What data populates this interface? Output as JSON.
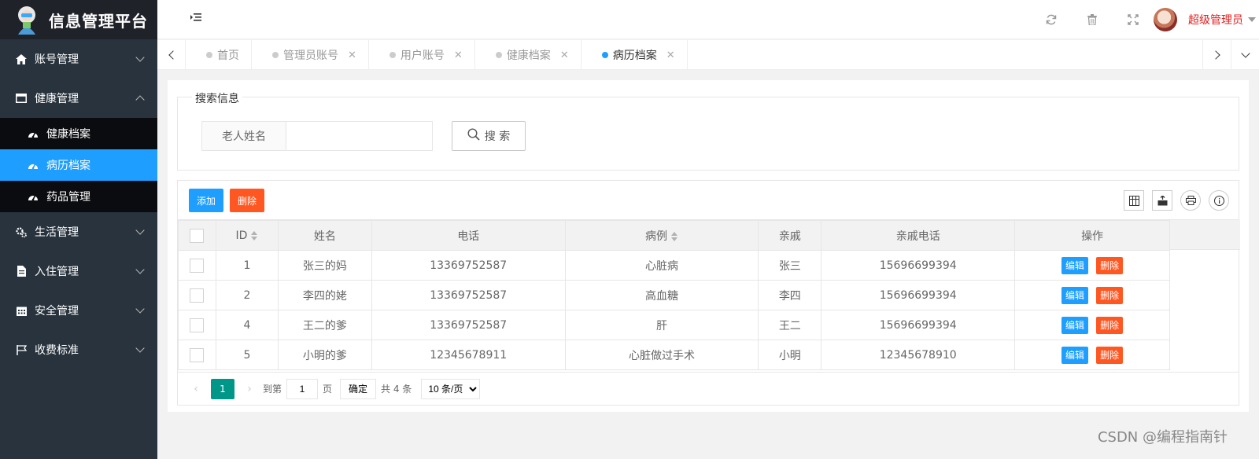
{
  "app": {
    "title": "信息管理平台"
  },
  "sidebar": {
    "menu": [
      {
        "label": "账号管理",
        "icon": "home-icon",
        "expanded": false
      },
      {
        "label": "健康管理",
        "icon": "window-icon",
        "expanded": true,
        "children": [
          {
            "label": "健康档案",
            "icon": "dashboard-icon",
            "active": false
          },
          {
            "label": "病历档案",
            "icon": "dashboard-icon",
            "active": true
          },
          {
            "label": "药品管理",
            "icon": "dashboard-icon",
            "active": false
          }
        ]
      },
      {
        "label": "生活管理",
        "icon": "gears-icon",
        "expanded": false
      },
      {
        "label": "入住管理",
        "icon": "file-icon",
        "expanded": false
      },
      {
        "label": "安全管理",
        "icon": "calendar-icon",
        "expanded": false
      },
      {
        "label": "收费标准",
        "icon": "flag-icon",
        "expanded": false
      }
    ]
  },
  "header": {
    "user_name": "超级管理员",
    "icons": [
      "refresh-icon",
      "trash-icon",
      "fullscreen-icon"
    ]
  },
  "tabs": [
    {
      "label": "首页",
      "closable": false,
      "active": false
    },
    {
      "label": "管理员账号",
      "closable": true,
      "active": false
    },
    {
      "label": "用户账号",
      "closable": true,
      "active": false
    },
    {
      "label": "健康档案",
      "closable": true,
      "active": false
    },
    {
      "label": "病历档案",
      "closable": true,
      "active": true
    }
  ],
  "search": {
    "legend": "搜索信息",
    "label": "老人姓名",
    "value": "",
    "placeholder": "",
    "button": "搜 索"
  },
  "toolbar": {
    "add_label": "添加",
    "delete_label": "删除"
  },
  "table": {
    "columns": [
      "ID",
      "姓名",
      "电话",
      "病例",
      "亲戚",
      "亲戚电话",
      "操作"
    ],
    "rows": [
      {
        "id": "1",
        "name": "张三的妈",
        "phone": "13369752587",
        "case": "心脏病",
        "relative": "张三",
        "relative_phone": "15696699394"
      },
      {
        "id": "2",
        "name": "李四的姥",
        "phone": "13369752587",
        "case": "高血糖",
        "relative": "李四",
        "relative_phone": "15696699394"
      },
      {
        "id": "4",
        "name": "王二的爹",
        "phone": "13369752587",
        "case": "肝",
        "relative": "王二",
        "relative_phone": "15696699394"
      },
      {
        "id": "5",
        "name": "小明的爹",
        "phone": "12345678911",
        "case": "心脏做过手术",
        "relative": "小明",
        "relative_phone": "12345678910"
      }
    ],
    "edit_label": "编辑",
    "delete_label": "删除"
  },
  "pager": {
    "current": "1",
    "goto_label": "到第",
    "page_input": "1",
    "page_unit": "页",
    "confirm": "确定",
    "total": "共 4 条",
    "page_size": "10 条/页"
  },
  "watermark": "CSDN @编程指南针"
}
